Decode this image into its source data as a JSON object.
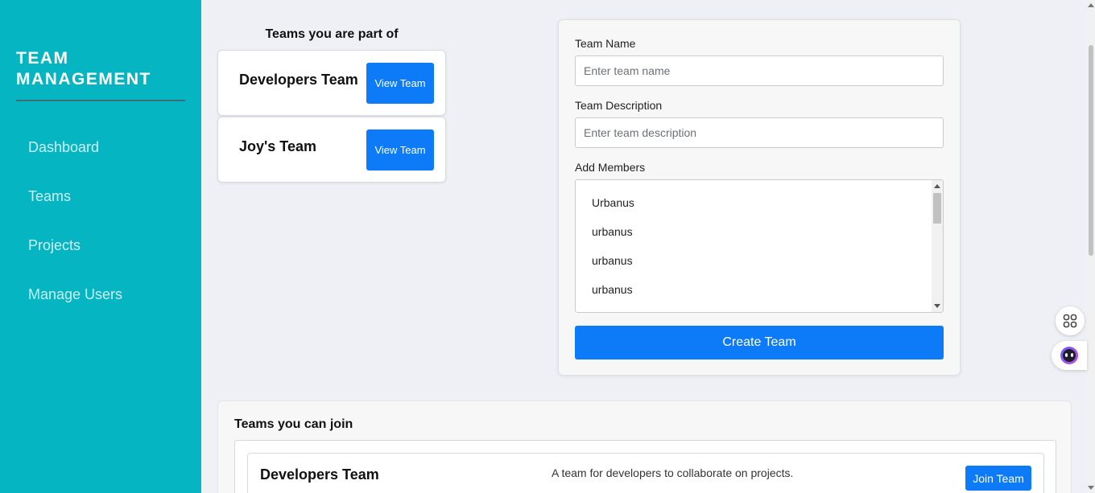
{
  "sidebar": {
    "brand_line1": "TEAM",
    "brand_line2": "MANAGEMENT",
    "items": [
      {
        "label": "Dashboard"
      },
      {
        "label": "Teams"
      },
      {
        "label": "Projects"
      },
      {
        "label": "Manage Users"
      }
    ]
  },
  "teams_part_of": {
    "title": "Teams you are part of",
    "teams": [
      {
        "name": "Developers Team",
        "button": "View Team"
      },
      {
        "name": "Joy's Team",
        "button": "View Team"
      }
    ]
  },
  "create_form": {
    "name_label": "Team Name",
    "name_placeholder": "Enter team name",
    "description_label": "Team Description",
    "description_placeholder": "Enter team description",
    "members_label": "Add Members",
    "members": [
      "Urbanus",
      "urbanus",
      "urbanus",
      "urbanus"
    ],
    "submit_label": "Create Team"
  },
  "join": {
    "title": "Teams you can join",
    "teams": [
      {
        "name": "Developers Team",
        "description": "A team for developers to collaborate on projects.",
        "button": "Join Team"
      }
    ]
  },
  "colors": {
    "sidebar": "#05b5c2",
    "primary": "#0d7bf7",
    "background": "#eef0f5"
  },
  "icons": {
    "float_top": "grid-icon",
    "float_bottom": "assistant-bot-icon"
  }
}
